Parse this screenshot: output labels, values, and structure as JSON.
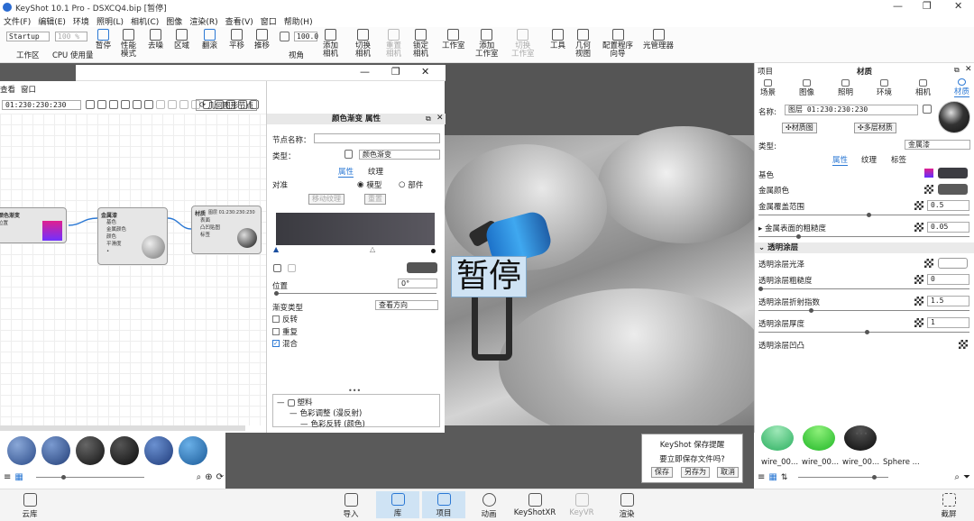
{
  "window": {
    "title": "KeyShot 10.1 Pro - DSXCQ4.bip [暂停]",
    "minimize": "—",
    "restore": "❐",
    "close": "✕"
  },
  "menu": [
    "文件(F)",
    "编辑(E)",
    "环境",
    "照明(L)",
    "相机(C)",
    "图像",
    "渲染(R)",
    "查看(V)",
    "窗口",
    "帮助(H)"
  ],
  "ribbon": {
    "workspace_select": "Startup",
    "cpu_select": "100 %",
    "zoom_value": "100.0",
    "workspace_label": "工作区",
    "cpu_label": "CPU 使用量",
    "buttons": [
      {
        "label": "暂停",
        "icon": "pause-icon",
        "state": "blue"
      },
      {
        "label": "性能\n模式",
        "icon": "performance-icon",
        "state": ""
      },
      {
        "label": "去噪",
        "icon": "denoise-icon",
        "state": ""
      },
      {
        "label": "区域",
        "icon": "region-icon",
        "state": ""
      },
      {
        "label": "翻滚",
        "icon": "tumble-icon",
        "state": "blue"
      },
      {
        "label": "平移",
        "icon": "pan-icon",
        "state": ""
      },
      {
        "label": "推移",
        "icon": "dolly-icon",
        "state": ""
      },
      {
        "label": "视角",
        "icon": "perspective-icon",
        "state": ""
      },
      {
        "label": "添加\n相机",
        "icon": "add-camera-icon",
        "state": ""
      },
      {
        "label": "切换\n相机",
        "icon": "switch-camera-icon",
        "state": ""
      },
      {
        "label": "重置\n相机",
        "icon": "reset-camera-icon",
        "state": "dim"
      },
      {
        "label": "锁定\n相机",
        "icon": "lock-camera-icon",
        "state": ""
      },
      {
        "label": "工作室",
        "icon": "studio-icon",
        "state": ""
      },
      {
        "label": "添加\n工作室",
        "icon": "add-studio-icon",
        "state": ""
      },
      {
        "label": "切换\n工作室",
        "icon": "switch-studio-icon",
        "state": "dim"
      },
      {
        "label": "工具",
        "icon": "tools-icon",
        "state": ""
      },
      {
        "label": "几何\n视图",
        "icon": "geometry-view-icon",
        "state": ""
      },
      {
        "label": "配置程序\n向导",
        "icon": "configurator-icon",
        "state": ""
      },
      {
        "label": "光管理器",
        "icon": "light-manager-icon",
        "state": ""
      }
    ]
  },
  "left_panel": {
    "menu": [
      "查看",
      "窗口"
    ],
    "id_field": "01:230:230:230",
    "geo_node_button": "几何图形节点",
    "nodes": {
      "gradient": {
        "title": "颜色渐变",
        "port": "位置"
      },
      "metal": {
        "title": "金属漆",
        "ports": [
          "基色",
          "金属颜色",
          "颜色",
          "平滑度",
          "•"
        ]
      },
      "material": {
        "title": "材质",
        "id": "图层 01:230:230:230",
        "ports": [
          "表面",
          "凸凹贴图",
          "标签"
        ]
      }
    }
  },
  "properties": {
    "header": "颜色渐变  属性",
    "node_name_label": "节点名称：",
    "node_name_value": "",
    "type_label": "类型：",
    "type_value": "颜色渐变",
    "tab_props": "属性",
    "tab_texture": "纹理",
    "align_label": "对准",
    "radio_model": "模型",
    "radio_part": "部件",
    "move_texture_btn": "移动纹理",
    "reset_btn": "重置",
    "position_label": "位置",
    "position_value": "0°",
    "gradient_type_label": "渐变类型",
    "gradient_type_value": "查看方向",
    "chk_invert": "反转",
    "chk_repeat": "重复",
    "chk_blend": "混合",
    "tree": [
      "塑料",
      "色彩调整 (漫反射)",
      "色彩反转 (颜色)"
    ]
  },
  "right_panel": {
    "tab_project": "项目",
    "tab_material": "材质",
    "subtabs": [
      "场景",
      "图像",
      "照明",
      "环境",
      "相机",
      "材质"
    ],
    "name_label": "名称:",
    "name_value": "图层 01:230:230:230",
    "material_graph_btn": "材质图",
    "multi_material_btn": "多层材质",
    "type_label": "类型:",
    "type_value": "金属漆",
    "tab_props": "属性",
    "tab_texture": "纹理",
    "tab_label": "标签",
    "base_color": "基色",
    "metal_color": "金属颜色",
    "metal_coverage": "金属覆盖范围",
    "metal_coverage_value": "0.5",
    "metal_roughness": "金属表面的粗糙度",
    "metal_roughness_value": "0.05",
    "clearcoat_section": "透明涂层",
    "clearcoat_gloss": "透明涂层光泽",
    "clearcoat_roughness": "透明涂层粗糙度",
    "clearcoat_roughness_value": "0",
    "clearcoat_ior": "透明涂层折射指数",
    "clearcoat_ior_value": "1.5",
    "clearcoat_thickness": "透明涂层厚度",
    "clearcoat_thickness_value": "1",
    "clearcoat_bump": "透明涂层凹凸"
  },
  "viewport": {
    "pause_text": "暂停"
  },
  "wire_library": [
    "wire_00...",
    "wire_00...",
    "wire_00...",
    "Sphere ..."
  ],
  "save_dialog": {
    "title": "KeyShot 保存提醒",
    "message": "要立即保存文件吗?",
    "save": "保存",
    "save_as": "另存为",
    "cancel": "取消"
  },
  "bottom_bar": [
    {
      "label": "云库",
      "icon": "cloud-library-icon",
      "state": ""
    },
    {
      "label": "导入",
      "icon": "import-icon",
      "state": ""
    },
    {
      "label": "库",
      "icon": "library-icon",
      "state": "act"
    },
    {
      "label": "项目",
      "icon": "project-icon",
      "state": "act"
    },
    {
      "label": "动画",
      "icon": "animation-icon",
      "state": ""
    },
    {
      "label": "KeyShotXR",
      "icon": "keyshotxr-icon",
      "state": ""
    },
    {
      "label": "KeyVR",
      "icon": "keyvr-icon",
      "state": "dim"
    },
    {
      "label": "渲染",
      "icon": "render-icon",
      "state": ""
    },
    {
      "label": "截屏",
      "icon": "screenshot-icon",
      "state": ""
    }
  ]
}
